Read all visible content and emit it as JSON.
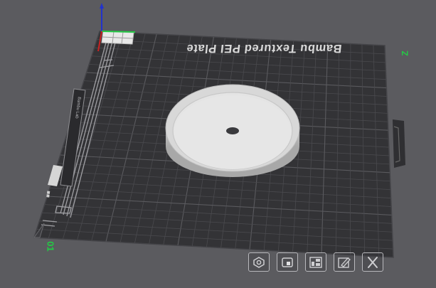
{
  "scene": {
    "background_color": "#5b5b5f",
    "plate_color": "#333336",
    "grid_color": "#4a4a4e",
    "plate_label": "Bambu Textured PEI Plate",
    "plate_number_left": "01",
    "plate_number_right": "Z",
    "axes": {
      "x_color": "#22cc44",
      "y_color": "#cc2222",
      "z_color": "#2233cc"
    },
    "object": {
      "name": "disc",
      "color": "#d8d8d8"
    },
    "sticker_text": "Bambu Lab"
  },
  "toolbar": {
    "buttons": [
      {
        "name": "orient-button",
        "icon": "hexagon-nut-icon"
      },
      {
        "name": "arrange-button",
        "icon": "cup-icon"
      },
      {
        "name": "plate-settings-button",
        "icon": "layout-icon"
      },
      {
        "name": "edit-plate-button",
        "icon": "pencil-sheet-icon"
      },
      {
        "name": "delete-plate-button",
        "icon": "close-icon"
      }
    ]
  }
}
